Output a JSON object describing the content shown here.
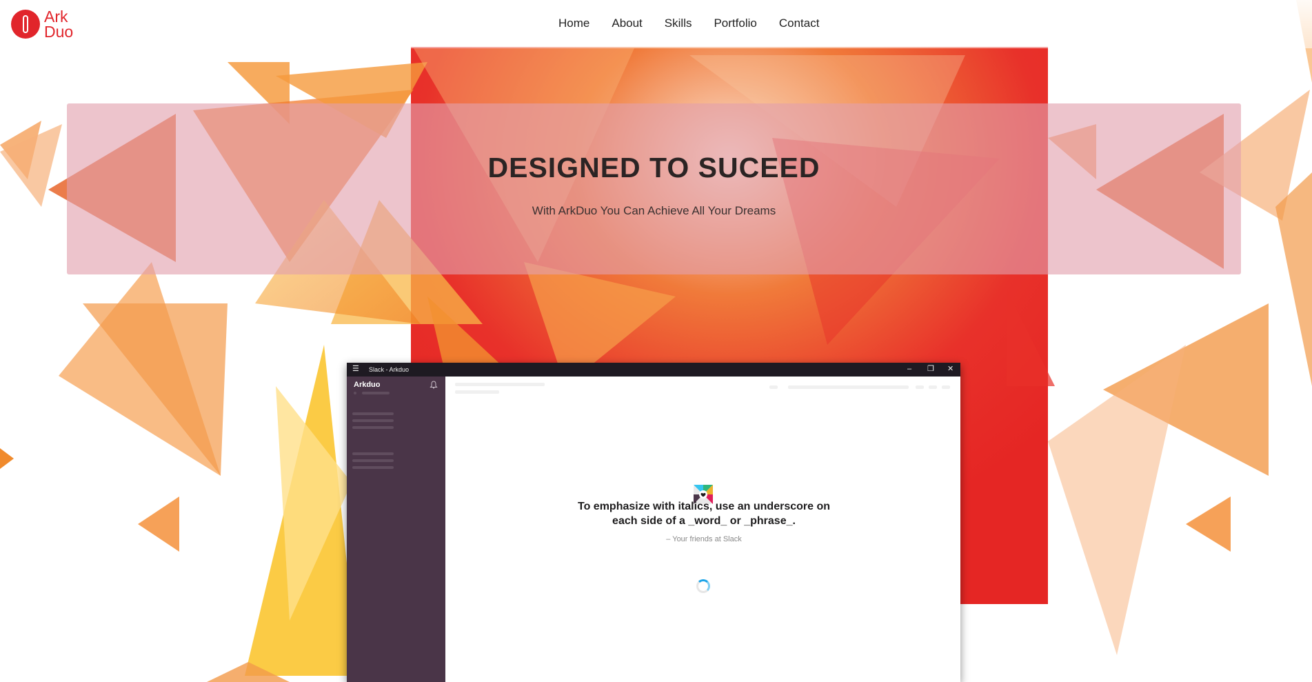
{
  "brand": {
    "line1": "Ark",
    "line2": "Duo",
    "color": "#e1252b"
  },
  "nav": {
    "items": [
      "Home",
      "About",
      "Skills",
      "Portfolio",
      "Contact"
    ]
  },
  "hero": {
    "title": "DESIGNED TO SUCEED",
    "subtitle": "With ArkDuo You Can Achieve All Your Dreams"
  },
  "app_window": {
    "title": "Slack - Arkduo",
    "menu_icon": "hamburger-icon",
    "workspace": "Arkduo",
    "tip": "To emphasize with italics, use an underscore on each side of a _word_ or _phrase_.",
    "tip_source": "– Your friends at Slack",
    "sidebar_color": "#4a3548",
    "titlebar_color": "#1e1a22"
  },
  "colors": {
    "accent": "#e1252b",
    "orange": "#f39a1f",
    "red": "#e8312a",
    "hero_band": "#e2a0ac"
  }
}
